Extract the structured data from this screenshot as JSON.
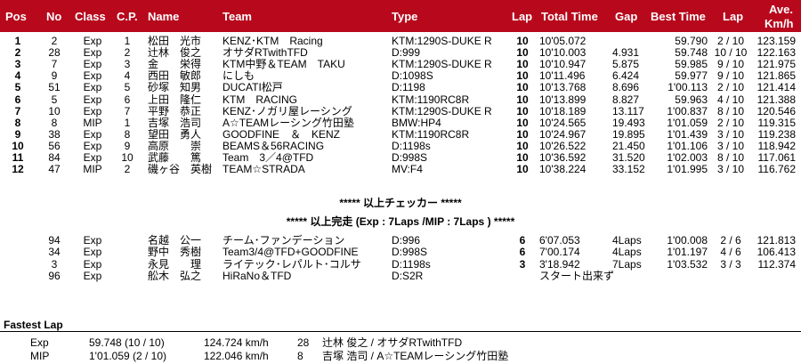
{
  "headers": {
    "pos": "Pos",
    "no": "No",
    "class": "Class",
    "cp": "C.P.",
    "name": "Name",
    "team": "Team",
    "type": "Type",
    "lap": "Lap",
    "total": "Total Time",
    "gap": "Gap",
    "best": "Best Time",
    "bestlap": "Lap",
    "ave1": "Ave.",
    "ave2": "Km/h"
  },
  "rows": [
    {
      "pos": "1",
      "no": "2",
      "cls": "Exp",
      "cp": "1",
      "name": "松田　光市",
      "team": "KENZ･KTM　Racing",
      "type": "KTM:1290S-DUKE R",
      "lap": "10",
      "total": "10'05.072",
      "gap": "",
      "best": "59.790",
      "bl": "2 / 10",
      "ave": "123.159"
    },
    {
      "pos": "2",
      "no": "28",
      "cls": "Exp",
      "cp": "2",
      "name": "辻林　俊之",
      "team": "オサダRTwithTFD",
      "type": "D:999",
      "lap": "10",
      "total": "10'10.003",
      "gap": "4.931",
      "best": "59.748",
      "bl": "10 / 10",
      "ave": "122.163"
    },
    {
      "pos": "3",
      "no": "7",
      "cls": "Exp",
      "cp": "3",
      "name": "金　　栄得",
      "team": "KTM中野＆TEAM　TAKU",
      "type": "KTM:1290S-DUKE R",
      "lap": "10",
      "total": "10'10.947",
      "gap": "5.875",
      "best": "59.985",
      "bl": "9 / 10",
      "ave": "121.975"
    },
    {
      "pos": "4",
      "no": "9",
      "cls": "Exp",
      "cp": "4",
      "name": "西田　敏郎",
      "team": "にしも",
      "type": "D:1098S",
      "lap": "10",
      "total": "10'11.496",
      "gap": "6.424",
      "best": "59.977",
      "bl": "9 / 10",
      "ave": "121.865"
    },
    {
      "pos": "5",
      "no": "51",
      "cls": "Exp",
      "cp": "5",
      "name": "砂塚　知男",
      "team": "DUCATI松戸",
      "type": "D:1198",
      "lap": "10",
      "total": "10'13.768",
      "gap": "8.696",
      "best": "1'00.113",
      "bl": "2 / 10",
      "ave": "121.414"
    },
    {
      "pos": "6",
      "no": "5",
      "cls": "Exp",
      "cp": "6",
      "name": "上田　隆仁",
      "team": "KTM　RACING",
      "type": "KTM:1190RC8R",
      "lap": "10",
      "total": "10'13.899",
      "gap": "8.827",
      "best": "59.963",
      "bl": "4 / 10",
      "ave": "121.388"
    },
    {
      "pos": "7",
      "no": "10",
      "cls": "Exp",
      "cp": "7",
      "name": "平野　恭正",
      "team": "KENZ･ノガリ屋レーシング",
      "type": "KTM:1290S-DUKE R",
      "lap": "10",
      "total": "10'18.189",
      "gap": "13.117",
      "best": "1'00.837",
      "bl": "8 / 10",
      "ave": "120.546"
    },
    {
      "pos": "8",
      "no": "8",
      "cls": "MIP",
      "cp": "1",
      "name": "吉塚　浩司",
      "team": "A☆TEAMレーシング竹田塾",
      "type": "BMW:HP4",
      "lap": "10",
      "total": "10'24.565",
      "gap": "19.493",
      "best": "1'01.059",
      "bl": "2 / 10",
      "ave": "119.315"
    },
    {
      "pos": "9",
      "no": "38",
      "cls": "Exp",
      "cp": "8",
      "name": "望田　勇人",
      "team": "GOODFINE　＆　KENZ",
      "type": "KTM:1190RC8R",
      "lap": "10",
      "total": "10'24.967",
      "gap": "19.895",
      "best": "1'01.439",
      "bl": "3 / 10",
      "ave": "119.238"
    },
    {
      "pos": "10",
      "no": "56",
      "cls": "Exp",
      "cp": "9",
      "name": "高原　　崇",
      "team": "BEAMS＆56RACING",
      "type": "D:1198s",
      "lap": "10",
      "total": "10'26.522",
      "gap": "21.450",
      "best": "1'01.106",
      "bl": "3 / 10",
      "ave": "118.942"
    },
    {
      "pos": "11",
      "no": "84",
      "cls": "Exp",
      "cp": "10",
      "name": "武藤　　篤",
      "team": "Team　3／4@TFD",
      "type": "D:998S",
      "lap": "10",
      "total": "10'36.592",
      "gap": "31.520",
      "best": "1'02.003",
      "bl": "8 / 10",
      "ave": "117.061"
    },
    {
      "pos": "12",
      "no": "47",
      "cls": "MIP",
      "cp": "2",
      "name": "磯ヶ谷　英樹",
      "team": "TEAM☆STRADA",
      "type": "MV:F4",
      "lap": "10",
      "total": "10'38.224",
      "gap": "33.152",
      "best": "1'01.995",
      "bl": "3 / 10",
      "ave": "116.762"
    }
  ],
  "checker_note": "***** 以上チェッカー *****",
  "finish_note": "***** 以上完走 (Exp : 7Laps /MIP : 7Laps ) *****",
  "others": [
    {
      "pos": "",
      "no": "94",
      "cls": "Exp",
      "cp": "",
      "name": "名越　公一",
      "team": "チーム･ファンデーション",
      "type": "D:996",
      "lap": "6",
      "total": "6'07.053",
      "gap": "4Laps",
      "best": "1'00.008",
      "bl": "2 / 6",
      "ave": "121.813"
    },
    {
      "pos": "",
      "no": "34",
      "cls": "Exp",
      "cp": "",
      "name": "野中　秀樹",
      "team": "Team3/4@TFD+GOODFINE",
      "type": "D:998S",
      "lap": "6",
      "total": "7'00.174",
      "gap": "4Laps",
      "best": "1'01.197",
      "bl": "4 / 6",
      "ave": "106.413"
    },
    {
      "pos": "",
      "no": "3",
      "cls": "Exp",
      "cp": "",
      "name": "永見　　理",
      "team": "ライテック･レパルト･コルサ",
      "type": "D:1198s",
      "lap": "3",
      "total": "3'18.942",
      "gap": "7Laps",
      "best": "1'03.532",
      "bl": "3 / 3",
      "ave": "112.374"
    },
    {
      "pos": "",
      "no": "96",
      "cls": "Exp",
      "cp": "",
      "name": "舩木　弘之",
      "team": "HiRaNo＆TFD",
      "type": "D:S2R",
      "lap": "",
      "total": "スタート出来ず",
      "gap": "",
      "best": "",
      "bl": "",
      "ave": ""
    }
  ],
  "fastest": {
    "title": "Fastest Lap",
    "rows": [
      {
        "cls": "Exp",
        "time": "59.748 (10 / 10)",
        "speed": "124.724 km/h",
        "no": "28",
        "who": "辻林  俊之 / オサダRTwithTFD"
      },
      {
        "cls": "MIP",
        "time": "1'01.059 (2 / 10)",
        "speed": "122.046 km/h",
        "no": "8",
        "who": "吉塚  浩司 / A☆TEAMレーシング竹田塾"
      }
    ]
  },
  "colors": {
    "header_bg": "#b8081c",
    "header_text": "#ffffff"
  }
}
